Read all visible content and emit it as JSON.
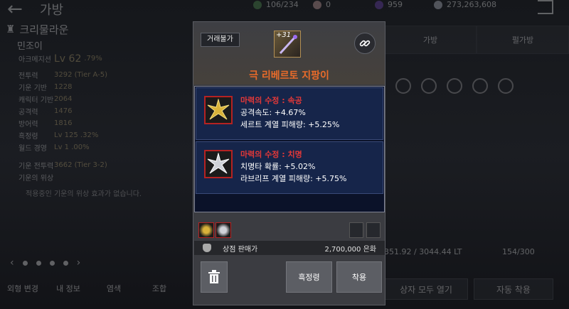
{
  "topbar": {
    "title": "가방",
    "currencies": [
      {
        "icon": "green-gem-icon",
        "value": "106/234",
        "color": "#5aa45a"
      },
      {
        "icon": "pearl-icon",
        "value": "0",
        "color": "#e9b8b8"
      },
      {
        "icon": "purple-orb-icon",
        "value": "959",
        "color": "#7a4bc9"
      },
      {
        "icon": "silver-coin-icon",
        "value": "273,263,608",
        "color": "#cfd6e2"
      }
    ]
  },
  "character": {
    "name": "크리물라운",
    "guild": "민조이",
    "class": "아크메지션",
    "level": "Lv 62",
    "level_pct": ".79%",
    "stats": [
      {
        "k": "전투력",
        "v": "3292 (Tier A-5)"
      },
      {
        "k": "기운 기반",
        "v": "1228"
      },
      {
        "k": "캐릭터 기반",
        "v": "2064"
      },
      {
        "k": "공격력",
        "v": "1476"
      },
      {
        "k": "방어력",
        "v": "1816"
      },
      {
        "k": "흑정령",
        "v": "Lv 125 .32%"
      },
      {
        "k": "월드 경영",
        "v": "Lv 1 .00%"
      }
    ],
    "spirit_power": {
      "k": "기운 전투력",
      "v": "3662 (Tier 3-2)"
    },
    "spirit_status_label": "기운의 위상",
    "notice": "적용중인 기운의 위상 효과가 없습니다."
  },
  "bottom_tabs": [
    "외형 변경",
    "내 정보",
    "염색",
    "조합"
  ],
  "right_panel": {
    "tabs": [
      "가방",
      "펄가방"
    ],
    "capacity_lt": "351.92 / 3044.44 LT",
    "slots": "154/300",
    "open_all_label": "상자 모두 열기",
    "auto_equip_label": "자동 착용"
  },
  "popup": {
    "trade_lock_label": "거래불가",
    "enhance_level": "+31",
    "item_name": "극 리베르토 지팡이",
    "sockets": [
      {
        "title": "마력의 수정 : 속공",
        "lines": [
          "공격속도: +4.67%",
          "세르트 계열 피해량: +5.25%"
        ],
        "gem_color": "#d9b23a"
      },
      {
        "title": "마력의 수정 : 치명",
        "lines": [
          "치명타 확률: +5.02%",
          "라브리프 계열 피해량: +5.75%"
        ],
        "gem_color": "#cfd2d8"
      }
    ],
    "sell_price_label": "상점 판매가",
    "sell_price_value": "2,700,000 은화",
    "black_spirit_button": "흑정령",
    "equip_button": "착용"
  }
}
